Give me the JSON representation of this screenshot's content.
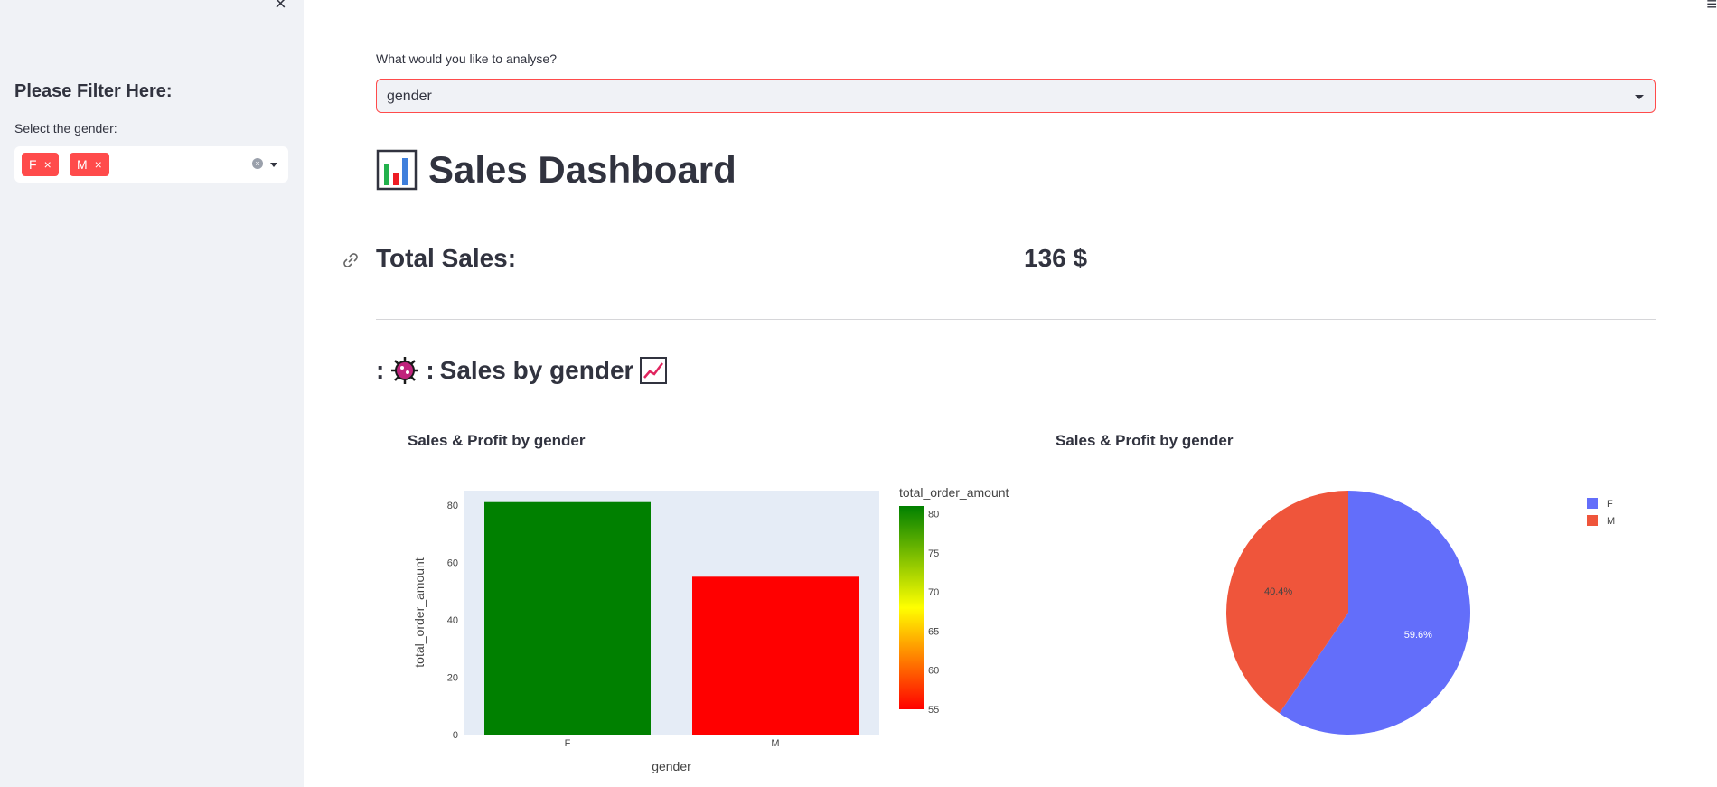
{
  "sidebar": {
    "close_symbol": "×",
    "title": "Please Filter Here:",
    "filter_label": "Select the gender:",
    "selected_tags": [
      "F",
      "M"
    ],
    "tag_remove_symbol": "×",
    "clear_symbol": "×"
  },
  "menu_symbol": "≡",
  "main": {
    "select_label": "What would you like to analyse?",
    "select_value": "gender",
    "title": "Sales Dashboard",
    "title_icon": "bar-chart-emoji-icon",
    "total_sales_label": "Total Sales:",
    "total_sales_value": "136 $",
    "section_prefix": ":",
    "section_mid": ":",
    "section_title": "Sales by gender",
    "section_icons": [
      "virus-emoji-icon",
      "chart-increasing-emoji-icon"
    ]
  },
  "colors": {
    "accent": "#ff4b4b",
    "bar_high": "#008000",
    "bar_low": "#ff0000",
    "pie_f": "#636efa",
    "pie_m": "#ef553b",
    "plot_bg": "#e5ecf6"
  },
  "chart_data": [
    {
      "type": "bar",
      "title": "Sales & Profit by gender",
      "categories": [
        "F",
        "M"
      ],
      "values": [
        81,
        55
      ],
      "xlabel": "gender",
      "ylabel": "total_order_amount",
      "ylim": [
        0,
        85
      ],
      "yticks": [
        0,
        20,
        40,
        60,
        80
      ],
      "colorbar": {
        "title": "total_order_amount",
        "range": [
          55,
          81
        ],
        "ticks": [
          55,
          60,
          65,
          70,
          75,
          80
        ],
        "colorscale": [
          "#ff0000",
          "#ffff00",
          "#008000"
        ]
      },
      "grid": false
    },
    {
      "type": "pie",
      "title": "Sales & Profit by gender",
      "labels": [
        "F",
        "M"
      ],
      "values": [
        81,
        55
      ],
      "percent_labels": [
        "59.6%",
        "40.4%"
      ],
      "legend": "top-right"
    }
  ]
}
